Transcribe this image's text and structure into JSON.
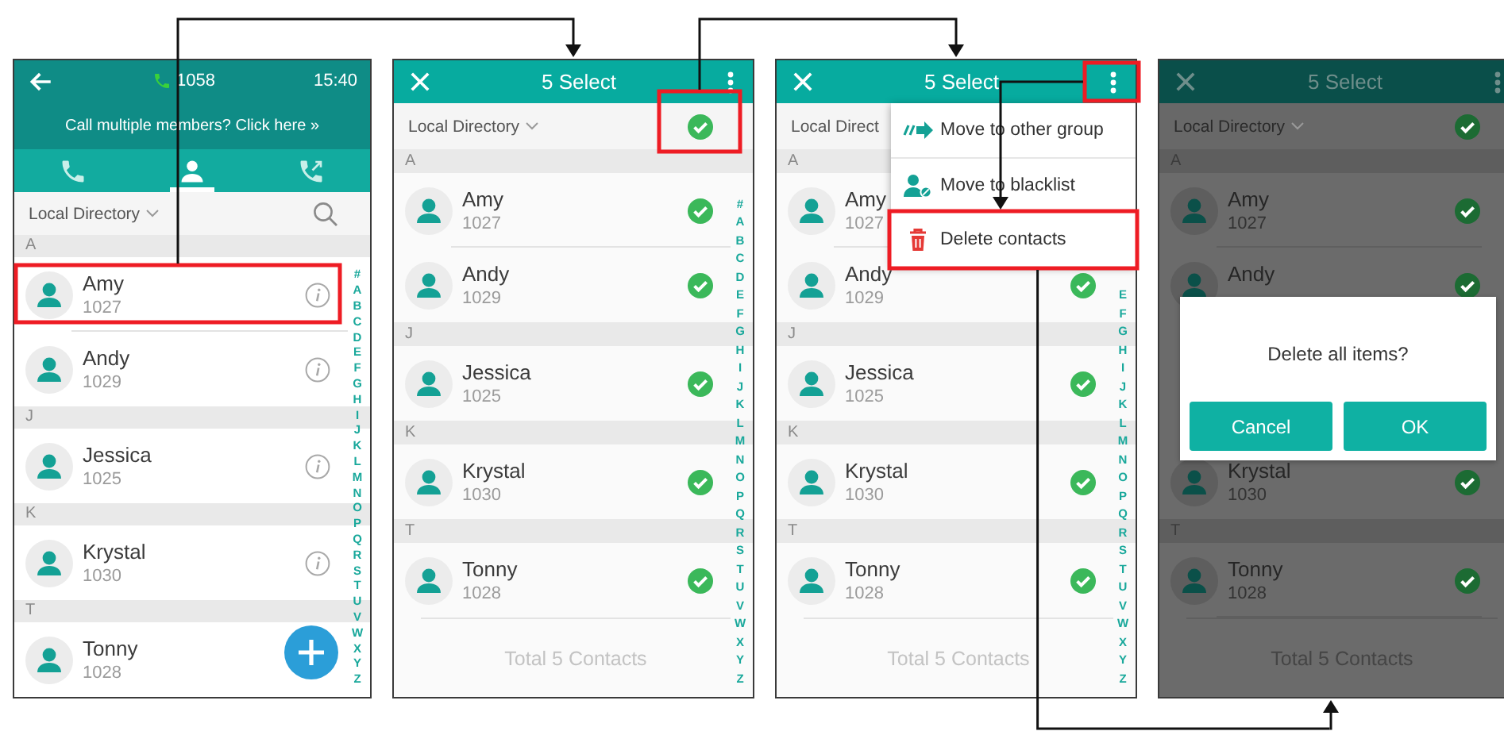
{
  "screens": [
    {
      "kind": "directory",
      "status_bar": {
        "extension": "1058",
        "time": "15:40"
      },
      "banner": "Call multiple members? Click here »",
      "tabs": [
        {
          "kind": "calls",
          "selected": false
        },
        {
          "kind": "contacts",
          "selected": true
        },
        {
          "kind": "transfer",
          "selected": false
        }
      ],
      "filter": {
        "label": "Local Directory"
      },
      "sections": [
        {
          "letter": "A",
          "contacts": [
            {
              "name": "Amy",
              "number": "1027",
              "highlighted": true
            },
            {
              "name": "Andy",
              "number": "1029"
            }
          ]
        },
        {
          "letter": "J",
          "contacts": [
            {
              "name": "Jessica",
              "number": "1025"
            }
          ]
        },
        {
          "letter": "K",
          "contacts": [
            {
              "name": "Krystal",
              "number": "1030"
            }
          ]
        },
        {
          "letter": "T",
          "contacts": [
            {
              "name": "Tonny",
              "number": "1028"
            }
          ]
        }
      ],
      "index": [
        "#",
        "A",
        "B",
        "C",
        "D",
        "E",
        "F",
        "G",
        "H",
        "I",
        "J",
        "K",
        "L",
        "M",
        "N",
        "O",
        "P",
        "Q",
        "R",
        "S",
        "T",
        "U",
        "V",
        "W",
        "X",
        "Y",
        "Z"
      ]
    },
    {
      "kind": "select",
      "title": "5 Select",
      "filter": {
        "label": "Local Directory",
        "checked": true,
        "highlighted": true
      },
      "sections": [
        {
          "letter": "A",
          "contacts": [
            {
              "name": "Amy",
              "number": "1027",
              "checked": true
            },
            {
              "name": "Andy",
              "number": "1029",
              "checked": true
            }
          ]
        },
        {
          "letter": "J",
          "contacts": [
            {
              "name": "Jessica",
              "number": "1025",
              "checked": true
            }
          ]
        },
        {
          "letter": "K",
          "contacts": [
            {
              "name": "Krystal",
              "number": "1030",
              "checked": true
            }
          ]
        },
        {
          "letter": "T",
          "contacts": [
            {
              "name": "Tonny",
              "number": "1028",
              "checked": true
            }
          ]
        }
      ],
      "index": [
        "#",
        "A",
        "B",
        "C",
        "D",
        "E",
        "F",
        "G",
        "H",
        "I",
        "J",
        "K",
        "L",
        "M",
        "N",
        "O",
        "P",
        "Q",
        "R",
        "S",
        "T",
        "U",
        "V",
        "W",
        "X",
        "Y",
        "Z"
      ],
      "footer": "Total 5 Contacts"
    },
    {
      "kind": "select",
      "title": "5 Select",
      "menu_button": {
        "highlighted": true
      },
      "filter": {
        "label": "Local Direct"
      },
      "sections": [
        {
          "letter": "A",
          "contacts": [
            {
              "name": "Amy",
              "number": "1027"
            },
            {
              "name": "Andy",
              "number": "1029",
              "checked": true
            }
          ]
        },
        {
          "letter": "J",
          "contacts": [
            {
              "name": "Jessica",
              "number": "1025",
              "checked": true
            }
          ]
        },
        {
          "letter": "K",
          "contacts": [
            {
              "name": "Krystal",
              "number": "1030",
              "checked": true
            }
          ]
        },
        {
          "letter": "T",
          "contacts": [
            {
              "name": "Tonny",
              "number": "1028",
              "checked": true
            }
          ]
        }
      ],
      "index": [
        "E",
        "F",
        "G",
        "H",
        "I",
        "J",
        "K",
        "L",
        "M",
        "N",
        "O",
        "P",
        "Q",
        "R",
        "S",
        "T",
        "U",
        "V",
        "W",
        "X",
        "Y",
        "Z"
      ],
      "menu": [
        {
          "kind": "move",
          "label": "Move to other group"
        },
        {
          "kind": "blacklist",
          "label": "Move to blacklist"
        },
        {
          "kind": "delete",
          "label": "Delete contacts",
          "highlighted": true
        }
      ],
      "footer": "Total 5 Contacts"
    },
    {
      "kind": "select",
      "dimmed": true,
      "title": "5 Select",
      "filter": {
        "label": "Local Directory",
        "checked": true
      },
      "sections": [
        {
          "letter": "A",
          "contacts": [
            {
              "name": "Amy",
              "number": "1027",
              "checked": true
            },
            {
              "name": "Andy",
              "checked": true
            }
          ]
        }
      ],
      "dialog": {
        "message": "Delete all items?",
        "buttons": [
          "Cancel",
          "OK"
        ]
      },
      "sections_below": [
        {
          "contacts": [
            {
              "name": "Krystal",
              "number": "1030",
              "checked": true
            }
          ]
        },
        {
          "letter": "T",
          "contacts": [
            {
              "name": "Tonny",
              "number": "1028",
              "checked": true
            }
          ]
        }
      ],
      "footer": "Total 5 Contacts"
    }
  ]
}
